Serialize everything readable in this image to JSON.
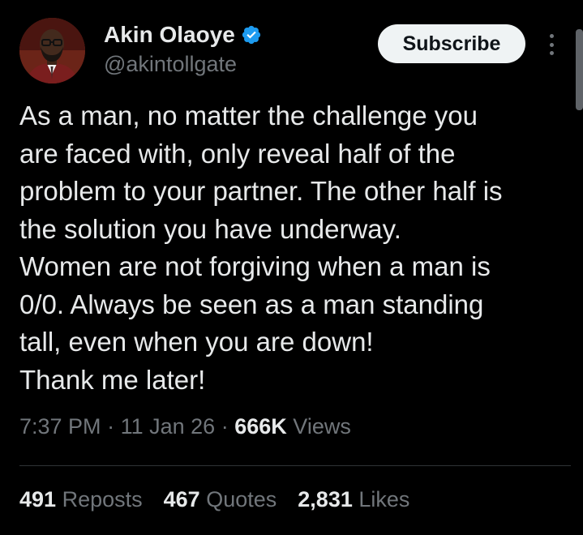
{
  "author": {
    "display_name": "Akin Olaoye",
    "handle": "@akintollgate",
    "verified_icon": "verified-badge-icon",
    "verified_color": "#1d9bf0"
  },
  "subscribe_label": "Subscribe",
  "more_icon": "more-vertical-icon",
  "tweet": {
    "lines": [
      "As a man, no matter the challenge you",
      "are faced with, only reveal half of the",
      "problem to your partner. The other half is",
      "the solution you have underway.",
      "Women are not forgiving when a man is",
      "0/0. Always be seen as a man standing",
      "tall, even when you are down!",
      "Thank me later!"
    ]
  },
  "meta": {
    "time": "7:37 PM",
    "date": "11 Jan 26",
    "separator": "·",
    "views_count": "666K",
    "views_label": "Views"
  },
  "stats": {
    "reposts_count": "491",
    "reposts_label": "Reposts",
    "quotes_count": "467",
    "quotes_label": "Quotes",
    "likes_count": "2,831",
    "likes_label": "Likes"
  },
  "colors": {
    "background": "#000000",
    "text_primary": "#e7e9ea",
    "text_secondary": "#71767b",
    "button_bg": "#eff3f4",
    "button_text": "#0f1419",
    "divider": "#2f3336"
  }
}
